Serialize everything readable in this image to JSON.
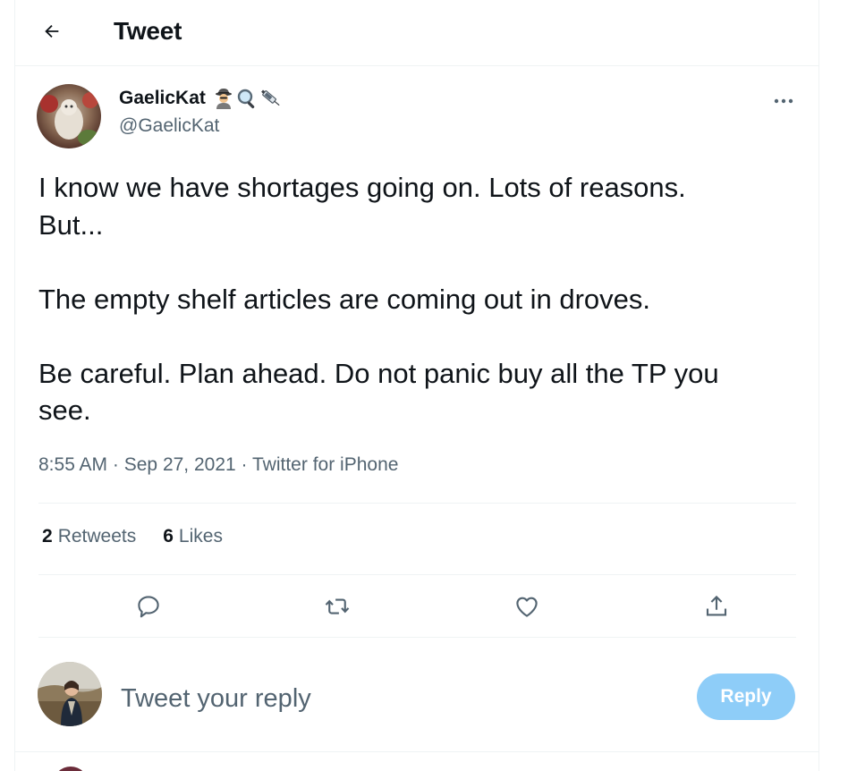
{
  "header": {
    "back_icon": "arrow-left-icon",
    "title": "Tweet"
  },
  "author": {
    "name": "GaelicKat",
    "name_emoji": [
      "detective-icon",
      "magnifying-glass-icon",
      "syringe-icon"
    ],
    "handle": "@GaelicKat",
    "more_icon": "ellipsis-icon"
  },
  "tweet": {
    "line1": "I know we have shortages going on. Lots of reasons.",
    "line2": "But...",
    "line3": "The empty shelf articles are coming out in droves.",
    "line4": "Be careful. Plan ahead. Do not panic buy all the TP you",
    "line5": "see.",
    "time": "8:55 AM",
    "date": "Sep 27, 2021",
    "source": "Twitter for iPhone",
    "dot": "·"
  },
  "stats": {
    "retweets_count": "2",
    "retweets_label": "Retweets",
    "likes_count": "6",
    "likes_label": "Likes"
  },
  "actions": [
    "reply-icon",
    "retweet-icon",
    "like-icon",
    "share-icon"
  ],
  "composer": {
    "placeholder": "Tweet your reply",
    "reply_label": "Reply"
  },
  "colors": {
    "text": "#0f1419",
    "secondary": "#536471",
    "border": "#eff3f4",
    "reply_button_disabled": "#8ecdf8"
  }
}
